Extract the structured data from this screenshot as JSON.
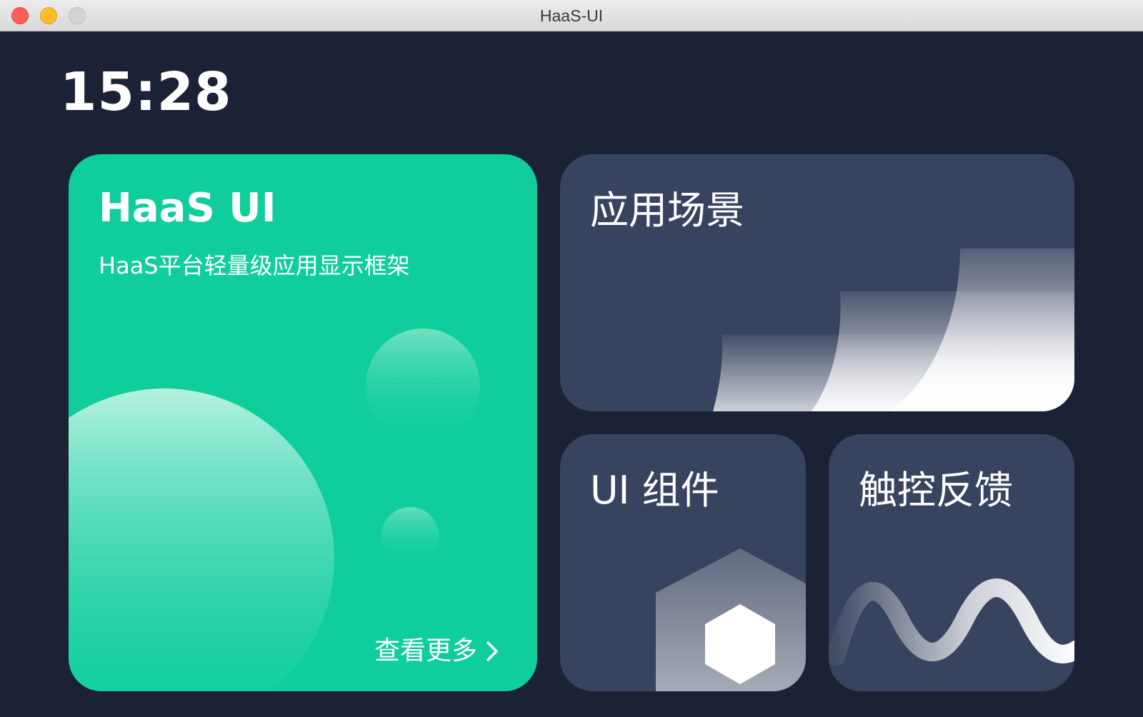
{
  "window": {
    "title": "HaaS-UI"
  },
  "clock": {
    "time": "15:28"
  },
  "cards": {
    "haas": {
      "title": "HaaS UI",
      "subtitle": "HaaS平台轻量级应用显示框架",
      "more_label": "查看更多",
      "color": "#0fce9c"
    },
    "scene": {
      "title": "应用场景"
    },
    "ui": {
      "title": "UI 组件"
    },
    "touch": {
      "title": "触控反馈"
    }
  },
  "theme": {
    "background": "#1c2236",
    "card_dark": "#38445f",
    "accent": "#0fce9c"
  },
  "icons": [
    "chevron-right-icon",
    "close-icon",
    "minimize-icon",
    "maximize-icon"
  ]
}
